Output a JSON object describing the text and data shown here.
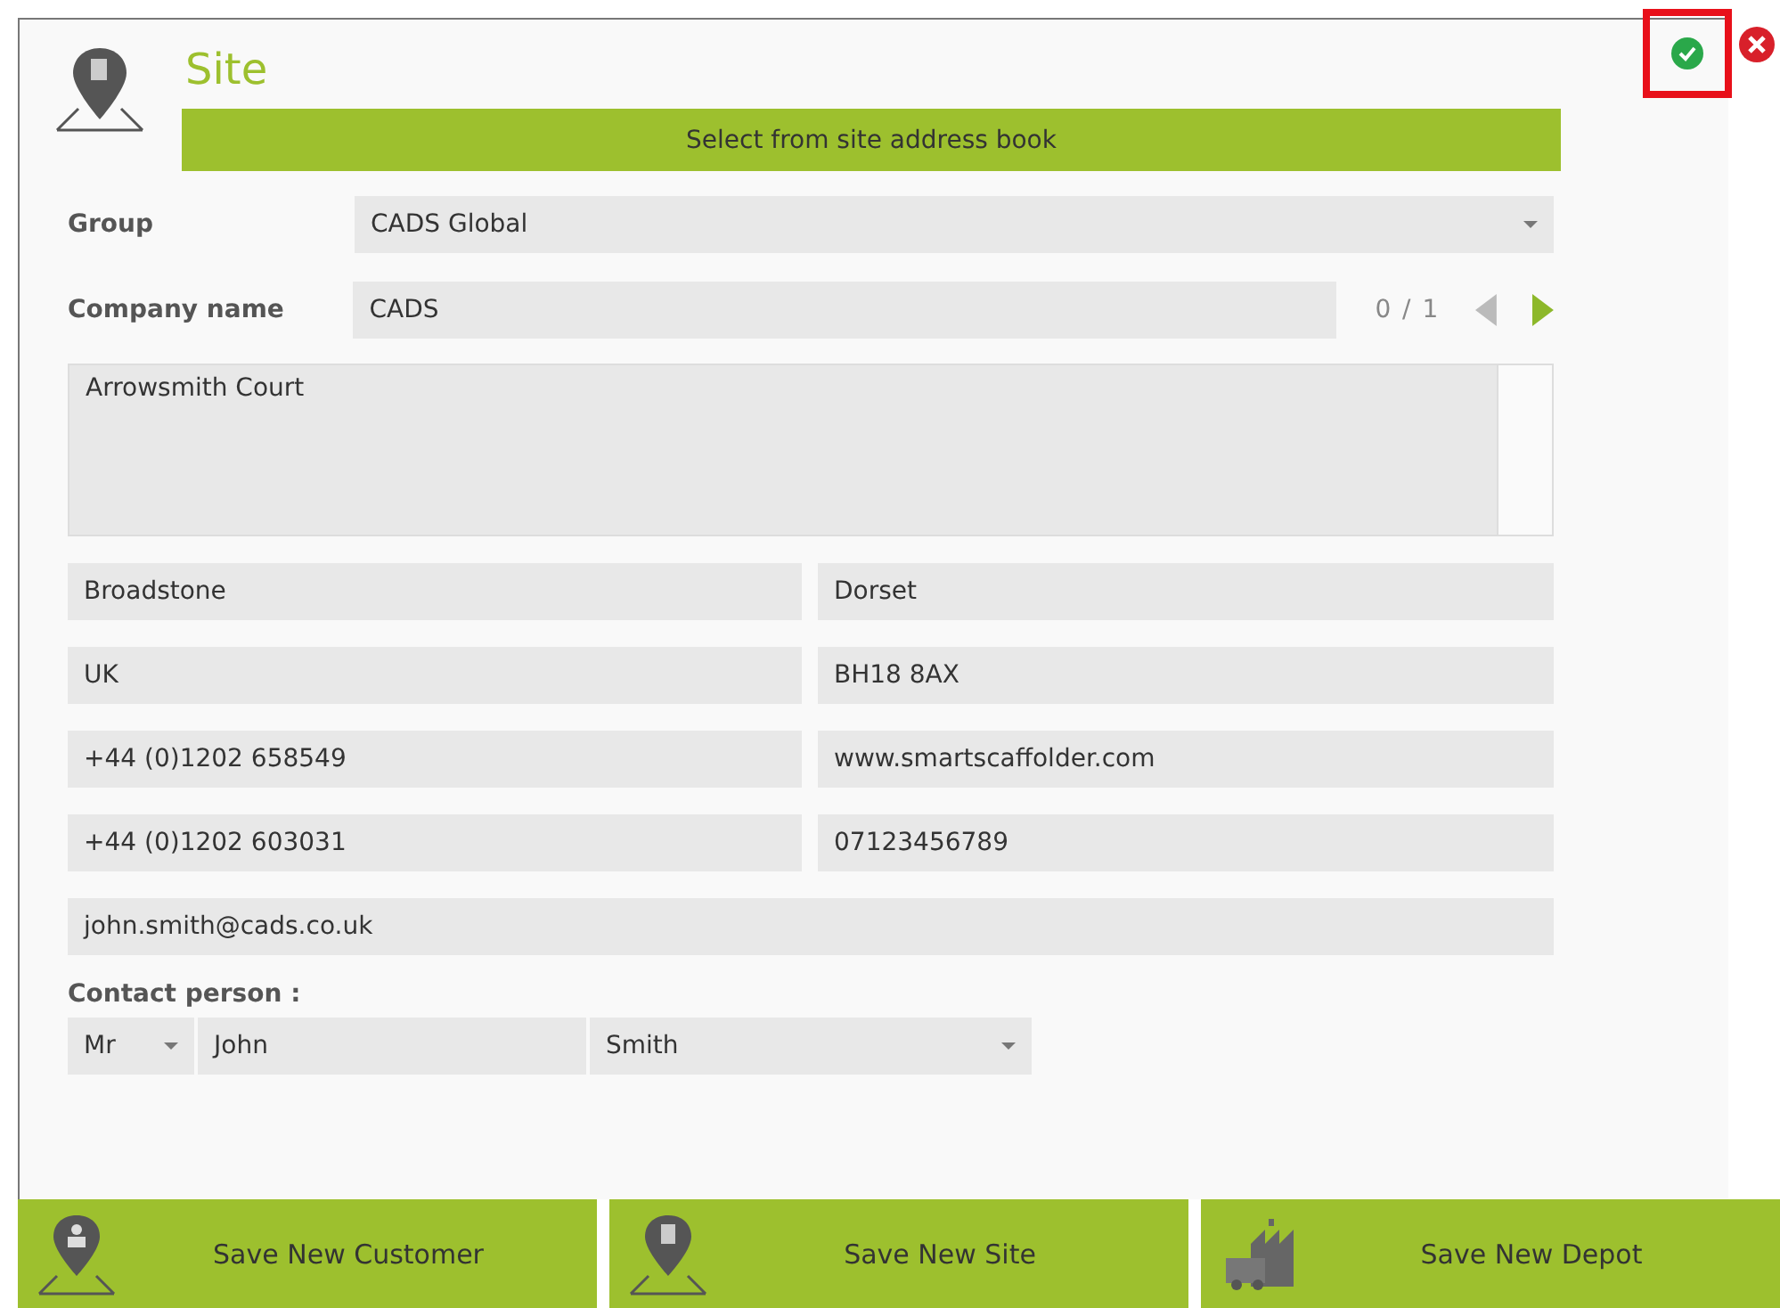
{
  "header": {
    "title": "Site",
    "address_book_button": "Select from site address book",
    "confirm_highlighted": true
  },
  "group": {
    "label": "Group",
    "value": "CADS Global"
  },
  "company": {
    "label": "Company name",
    "value": "CADS",
    "pager": "0 / 1"
  },
  "address": {
    "value": "Arrowsmith Court"
  },
  "fields": [
    {
      "value": "Broadstone"
    },
    {
      "value": "Dorset"
    },
    {
      "value": "UK"
    },
    {
      "value": "BH18 8AX"
    },
    {
      "value": "+44 (0)1202 658549"
    },
    {
      "value": "www.smartscaffolder.com"
    },
    {
      "value": "+44 (0)1202 603031"
    },
    {
      "value": "07123456789"
    }
  ],
  "email": {
    "value": "john.smith@cads.co.uk"
  },
  "contact": {
    "label": "Contact person :",
    "title": "Mr",
    "first_name": "John",
    "last_name": "Smith"
  },
  "buttons": [
    {
      "kind": "customer",
      "label": "Save New Customer"
    },
    {
      "kind": "site",
      "label": "Save New Site"
    },
    {
      "kind": "depot",
      "label": "Save New Depot"
    }
  ]
}
